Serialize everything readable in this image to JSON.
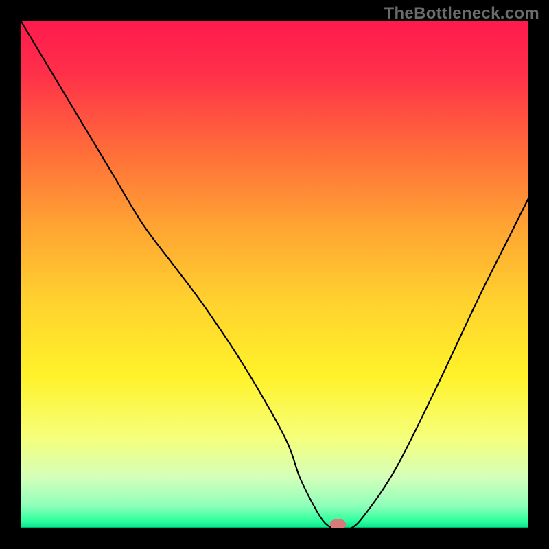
{
  "watermark": "TheBottleneck.com",
  "chart_data": {
    "type": "line",
    "title": "",
    "xlabel": "",
    "ylabel": "",
    "xlim": [
      0,
      100
    ],
    "ylim": [
      0,
      100
    ],
    "series": [
      {
        "name": "curve",
        "x": [
          0,
          6,
          12,
          18,
          24,
          30,
          36,
          44,
          52,
          55,
          58,
          60,
          62,
          65,
          68,
          74,
          82,
          90,
          96,
          100
        ],
        "y": [
          100,
          90,
          80,
          70,
          60,
          52,
          44,
          32,
          18,
          10,
          4,
          1,
          0,
          0,
          3,
          12,
          28,
          45,
          57,
          65
        ]
      }
    ],
    "marker": {
      "x": 62.5,
      "y": 0.8,
      "rx": 1.6,
      "ry": 1.1,
      "color": "#d67a7a"
    },
    "gradient_stops": [
      {
        "offset": 0.0,
        "color": "#ff1a4d"
      },
      {
        "offset": 0.1,
        "color": "#ff2e4a"
      },
      {
        "offset": 0.25,
        "color": "#ff6a3a"
      },
      {
        "offset": 0.4,
        "color": "#ffa233"
      },
      {
        "offset": 0.55,
        "color": "#ffd12e"
      },
      {
        "offset": 0.7,
        "color": "#fff22a"
      },
      {
        "offset": 0.82,
        "color": "#f6ff7a"
      },
      {
        "offset": 0.9,
        "color": "#d4ffba"
      },
      {
        "offset": 0.955,
        "color": "#8fffba"
      },
      {
        "offset": 0.985,
        "color": "#2fff9e"
      },
      {
        "offset": 1.0,
        "color": "#00e28a"
      }
    ]
  }
}
